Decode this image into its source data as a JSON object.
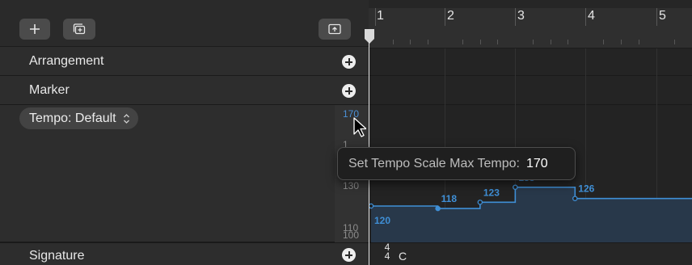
{
  "toolbar": {
    "add_icon": "plus-icon",
    "duplicate_icon": "duplicate-track-icon",
    "collapse_icon": "collapse-global-tracks-icon"
  },
  "tracks": {
    "arrangement": {
      "label": "Arrangement"
    },
    "marker": {
      "label": "Marker"
    },
    "tempo": {
      "selector_label": "Tempo: Default",
      "selector_icon": "up-down-chevron-icon"
    },
    "signature": {
      "label": "Signature"
    }
  },
  "tempo_scale": {
    "top_label": "170",
    "partial_label": "1",
    "mid_label": "130",
    "low_label_1": "110",
    "low_label_2": "100"
  },
  "ruler": {
    "bars": [
      "1",
      "2",
      "3",
      "4",
      "5"
    ]
  },
  "tempo_curve": {
    "points": [
      {
        "tempo": "120",
        "bar": 1.0
      },
      {
        "tempo": "118",
        "bar": 1.95
      },
      {
        "tempo": "123",
        "bar": 2.55
      },
      {
        "tempo": "135",
        "bar": 3.05
      },
      {
        "tempo": "126",
        "bar": 3.9
      }
    ],
    "color": "#3f8fd6",
    "fill": "#28384a"
  },
  "signature": {
    "numerator": "4",
    "denominator": "4",
    "key": "C"
  },
  "tooltip": {
    "label": "Set Tempo Scale Max Tempo:",
    "value": "170"
  }
}
